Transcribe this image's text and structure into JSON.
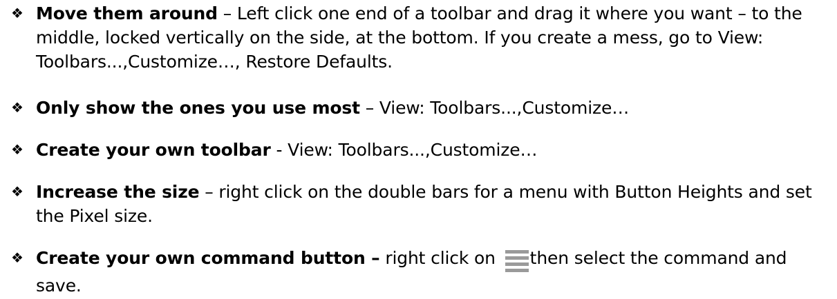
{
  "bullets": [
    {
      "lead": "Move them around",
      "text": " – Left click one end of a toolbar and drag it where you want – to the middle, locked vertically on the side, at the bottom. If you create a mess, go to View: Toolbars...,Customize…, Restore Defaults."
    },
    {
      "lead": "Only show the ones you use most",
      "text": " – View: Toolbars...,Customize…"
    },
    {
      "lead": "Create your own toolbar",
      "text": " - View: Toolbars...,Customize…"
    },
    {
      "lead": "Increase the size",
      "text": " – right click on the double bars for a menu with Button Heights and set the Pixel size."
    },
    {
      "lead": "Create your own command button –",
      "text_before_icon": " right click on ",
      "icon": "toolbar-handle-icon",
      "text_after_icon": "then select the command and save."
    }
  ],
  "bullet_glyph": "❖",
  "colors": {
    "text": "#000000",
    "icon": "#9a9a9a"
  }
}
